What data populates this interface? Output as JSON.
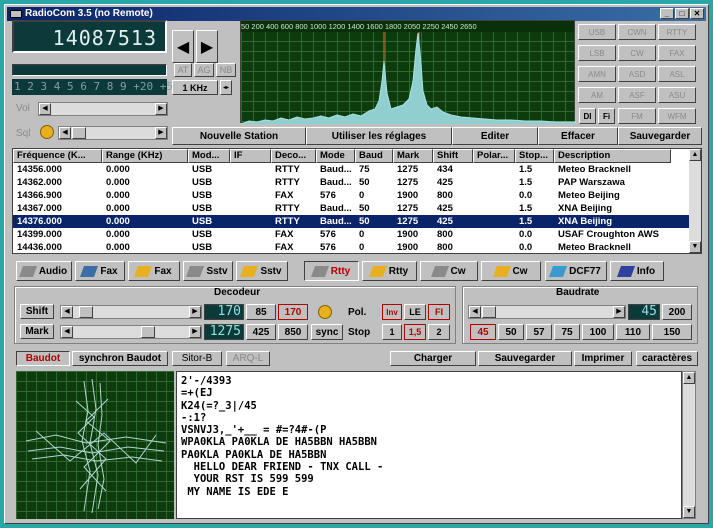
{
  "window": {
    "title": "RadioCom 3.5 (no Remote)",
    "minimize": "_",
    "maximize": "□",
    "close": "✕"
  },
  "freq_display": "14087513",
  "prev_arrow": "◀",
  "next_arrow": "▶",
  "filters": [
    "AT",
    "AG",
    "NB"
  ],
  "memories": "1 2 3 4 5 6 7 8 9 +20 +50",
  "step": "1 KHz",
  "vol_label": "Vol",
  "sql_label": "Sql",
  "mode_buttons": [
    [
      "USB",
      "CWN",
      "RTTY"
    ],
    [
      "LSB",
      "CW",
      "FAX"
    ],
    [
      "AMN",
      "ASD",
      "ASL"
    ],
    [
      "AM",
      "ASF",
      "ASU"
    ]
  ],
  "small_btns": [
    "DI",
    "Fi"
  ],
  "mode_extra": [
    "FM",
    "WFM"
  ],
  "spectrum_scale": "50  200   400   600   800  1000 1200 1400  1600  1800   2050 2250 2450 2650",
  "actions": [
    "Nouvelle Station",
    "Utiliser les réglages",
    "Editer",
    "Effacer",
    "Sauvegarder"
  ],
  "table": {
    "headers": [
      "Fréquence (K...",
      "Range (KHz)",
      "Mod...",
      "IF",
      "Deco...",
      "Mode",
      "Baud",
      "Mark",
      "Shift",
      "Polar...",
      "Stop...",
      "Description"
    ],
    "rows": [
      [
        "14356.000",
        "0.000",
        "USB",
        "",
        "RTTY",
        "Baud...",
        "75",
        "1275",
        "434",
        "",
        "1.5",
        "Meteo Bracknell"
      ],
      [
        "14362.000",
        "0.000",
        "USB",
        "",
        "RTTY",
        "Baud...",
        "50",
        "1275",
        "425",
        "",
        "1.5",
        "PAP Warszawa"
      ],
      [
        "14366.900",
        "0.000",
        "USB",
        "",
        "FAX",
        "576",
        "0",
        "1900",
        "800",
        "",
        "0.0",
        "Meteo Beijing"
      ],
      [
        "14367.000",
        "0.000",
        "USB",
        "",
        "RTTY",
        "Baud...",
        "50",
        "1275",
        "425",
        "",
        "1.5",
        "XNA Beijing"
      ],
      [
        "14376.000",
        "0.000",
        "USB",
        "",
        "RTTY",
        "Baud...",
        "50",
        "1275",
        "425",
        "",
        "1.5",
        "XNA Beijing"
      ],
      [
        "14399.000",
        "0.000",
        "USB",
        "",
        "FAX",
        "576",
        "0",
        "1900",
        "800",
        "",
        "0.0",
        "USAF Croughton AWS"
      ],
      [
        "14436.000",
        "0.000",
        "USB",
        "",
        "FAX",
        "576",
        "0",
        "1900",
        "800",
        "",
        "0.0",
        "Meteo Bracknell"
      ]
    ],
    "selected_index": 4
  },
  "decode_modes": [
    "Audio",
    "Fax",
    "Fax",
    "Sstv",
    "Sstv",
    "Rtty",
    "Rtty",
    "Cw",
    "Cw",
    "DCF77",
    "Info"
  ],
  "active_mode_index": 5,
  "decodeur": {
    "title": "Decodeur",
    "shift_label": "Shift",
    "shift_value": "170",
    "shift_presets": [
      "85",
      "170"
    ],
    "mark_label": "Mark",
    "mark_value": "1275",
    "mark_presets": [
      "425",
      "850"
    ],
    "sync": "sync",
    "pol_label": "Pol.",
    "pol_buttons": [
      "Inv",
      "LE",
      "FI"
    ],
    "stop_label": "Stop",
    "stop_buttons": [
      "1",
      "1,5",
      "2"
    ]
  },
  "baudrate": {
    "title": "Baudrate",
    "value": "45",
    "presets": [
      "200",
      "45",
      "50",
      "57",
      "75",
      "100",
      "110",
      "150"
    ]
  },
  "tabs": [
    "Baudot",
    "synchron Baudot",
    "Sitor-B",
    "ARQ-L"
  ],
  "tab_actions": [
    "Charger",
    "Sauvegarder",
    "Imprimer",
    "caractères"
  ],
  "text_lines": [
    "2'-/4393",
    "=+(EJ",
    "K24(=?_3|/45",
    "-:1?",
    "VSNVJ3,_'+__ = #=?4#-(P",
    "WPA0KLA PA0KLA DE HA5BBN HA5BBN",
    "PA0KLA PA0KLA DE HA5BBN",
    "  HELLO DEAR FRIEND - TNX CALL -",
    "  YOUR RST IS 599 599",
    " MY NAME IS EDE E"
  ]
}
